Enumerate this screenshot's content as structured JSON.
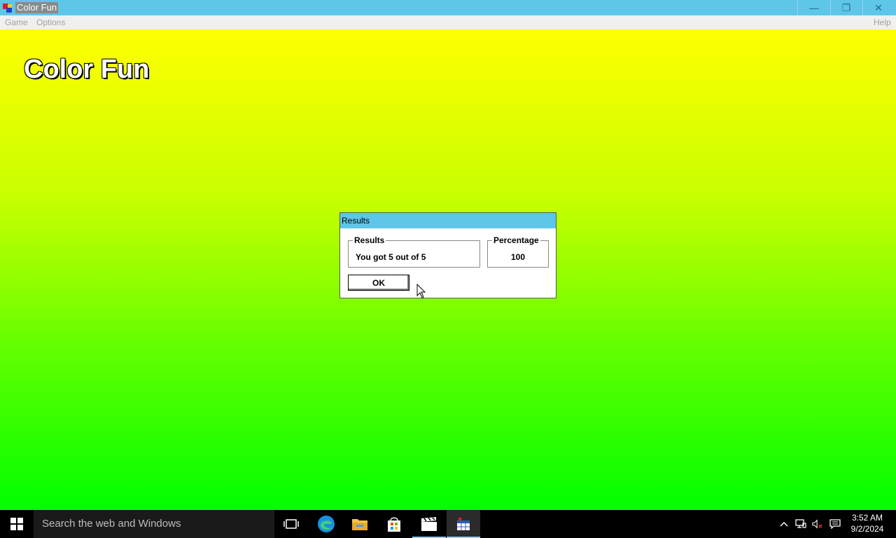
{
  "window": {
    "title": "Color Fun",
    "minimize_glyph": "—",
    "maximize_glyph": "❐",
    "close_glyph": "✕"
  },
  "menu": {
    "game": "Game",
    "options": "Options",
    "help": "Help"
  },
  "app": {
    "big_title": "Color Fun",
    "background_top": "#ffff00",
    "background_bottom": "#00ff00"
  },
  "dialog": {
    "title": "Results",
    "results_label": "Results",
    "results_value": "You got 5 out of 5",
    "percentage_label": "Percentage",
    "percentage_value": "100",
    "ok_label": "OK"
  },
  "taskbar": {
    "search_placeholder": "Search the web and Windows",
    "time": "3:52 AM",
    "date": "9/2/2024",
    "icons": [
      "start-icon",
      "task-view-icon",
      "edge-icon",
      "file-explorer-icon",
      "store-icon",
      "movies-icon",
      "color-fun-app-icon"
    ],
    "tray_icons": [
      "chevron-up-icon",
      "network-icon",
      "volume-muted-icon",
      "notifications-icon"
    ]
  },
  "colors": {
    "titlebar": "#5ec6e8",
    "taskbar": "#000000"
  }
}
